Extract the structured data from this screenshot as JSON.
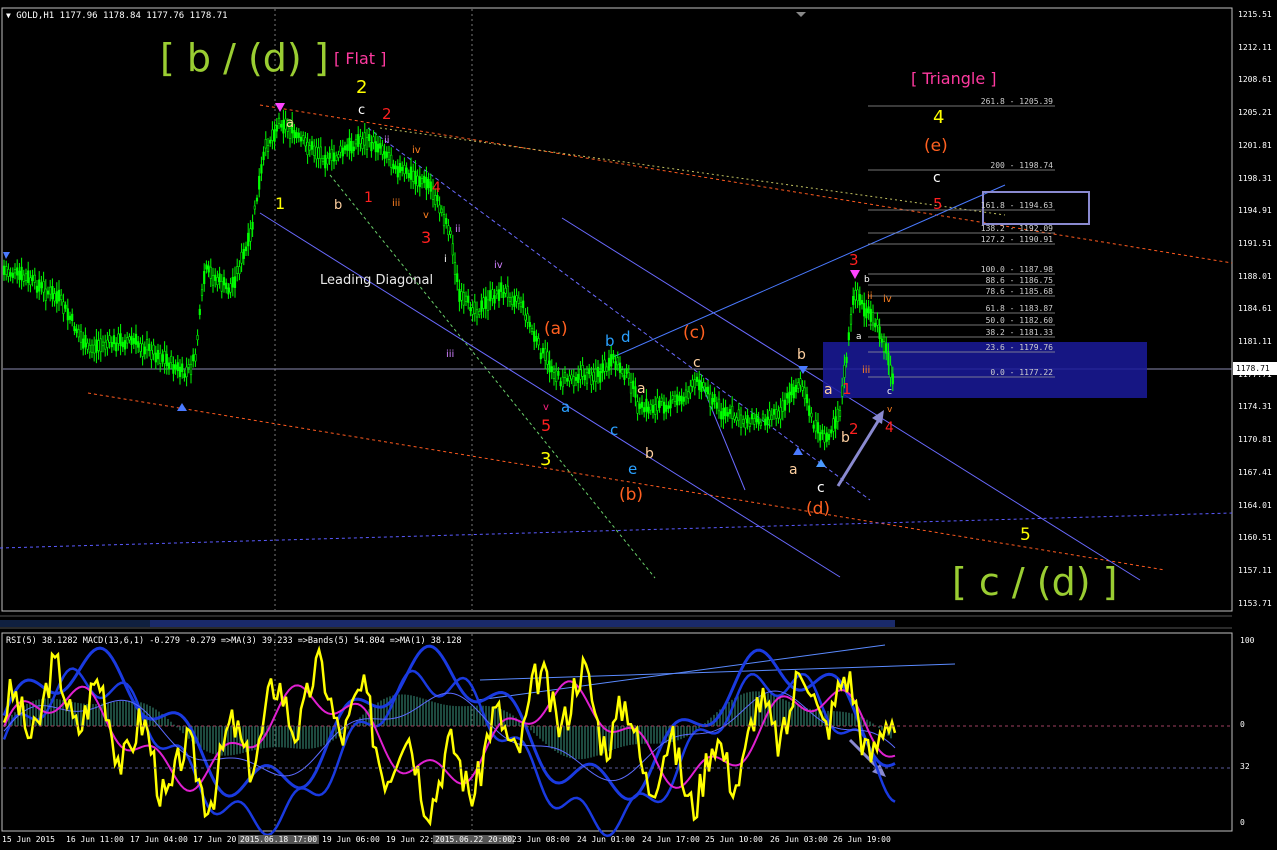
{
  "header": {
    "symbol_line": "GOLD,H1  1177.96 1178.84 1177.76 1178.71",
    "dropdown_icon": "triangle-down-icon"
  },
  "price_axis": {
    "ticks": [
      "1215.51",
      "1212.11",
      "1208.61",
      "1205.21",
      "1201.81",
      "1198.31",
      "1194.91",
      "1191.51",
      "1188.01",
      "1184.61",
      "1181.11",
      "1177.71",
      "1174.31",
      "1170.81",
      "1167.41",
      "1164.01",
      "1160.51",
      "1157.11",
      "1153.71"
    ],
    "current_price": "1178.71"
  },
  "time_axis": {
    "labels": [
      "15 Jun 2015",
      "16 Jun 11:00",
      "17 Jun 04:00",
      "17 Jun 20:00",
      "2015.06.18 17:00",
      "19 Jun 06:00",
      "19 Jun 22:00",
      "2015.06.22 20:00",
      "23 Jun 08:00",
      "24 Jun 01:00",
      "24 Jun 17:00",
      "25 Jun 10:00",
      "26 Jun 03:00",
      "26 Jun 19:00"
    ]
  },
  "annotations": {
    "big_b_d": "[ b / (d) ]",
    "big_c_d": "[ c / (d) ]",
    "flat": "[ Flat ]",
    "triangle": "[ Triangle ]",
    "leading_diagonal": "Leading Diagonal",
    "wave_labels": [
      {
        "t": "2"
      },
      {
        "t": "c"
      },
      {
        "t": "a"
      },
      {
        "t": "2"
      },
      {
        "t": "1"
      },
      {
        "t": "b"
      },
      {
        "t": "1"
      },
      {
        "t": "ii"
      },
      {
        "t": "iv"
      },
      {
        "t": "iii"
      },
      {
        "t": "4"
      },
      {
        "t": "v"
      },
      {
        "t": "3"
      },
      {
        "t": "ii"
      },
      {
        "t": "i"
      },
      {
        "t": "iv"
      },
      {
        "t": "iii"
      },
      {
        "t": "(a)"
      },
      {
        "t": "b"
      },
      {
        "t": "d"
      },
      {
        "t": "v"
      },
      {
        "t": "a"
      },
      {
        "t": "5"
      },
      {
        "t": "3"
      },
      {
        "t": "c"
      },
      {
        "t": "a"
      },
      {
        "t": "e"
      },
      {
        "t": "b"
      },
      {
        "t": "(b)"
      },
      {
        "t": "(c)"
      },
      {
        "t": "c"
      },
      {
        "t": "b"
      },
      {
        "t": "a"
      },
      {
        "t": "a"
      },
      {
        "t": "1"
      },
      {
        "t": "2"
      },
      {
        "t": "b"
      },
      {
        "t": "c"
      },
      {
        "t": "(d)"
      },
      {
        "t": "3"
      },
      {
        "t": "b"
      },
      {
        "t": "ii"
      },
      {
        "t": "iv"
      },
      {
        "t": "a"
      },
      {
        "t": "iii"
      },
      {
        "t": "c"
      },
      {
        "t": "v"
      },
      {
        "t": "4"
      },
      {
        "t": "4"
      },
      {
        "t": "(e)"
      },
      {
        "t": "c"
      },
      {
        "t": "5"
      },
      {
        "t": "5"
      }
    ],
    "fib_levels": [
      {
        "label": "261.8 - 1205.39"
      },
      {
        "label": "200 - 1198.74"
      },
      {
        "label": "161.8 - 1194.63"
      },
      {
        "label": "138.2 - 1192.09"
      },
      {
        "label": "127.2 - 1190.91"
      },
      {
        "label": "100.0 - 1187.98"
      },
      {
        "label": "88.6 - 1186.75"
      },
      {
        "label": "78.6 - 1185.68"
      },
      {
        "label": "61.8 - 1183.87"
      },
      {
        "label": "50.0 - 1182.60"
      },
      {
        "label": "38.2 - 1181.33"
      },
      {
        "label": "23.6 - 1179.76"
      },
      {
        "label": "0.0 - 1177.22"
      }
    ]
  },
  "indicator": {
    "header_line": "RSI(5) 38.1282  MACD(13,6,1) -0.279 -0.279  =>MA(3) 39.233  =>Bands(5) 54.804  =>MA(1) 38.128",
    "axis_ticks": [
      "100",
      "0",
      "32",
      "0"
    ]
  },
  "colors": {
    "candle": "#00ff00",
    "bg": "#000000",
    "yellow": "#ffff00",
    "magenta": "#ff00ff",
    "lime_text": "#9acd32"
  }
}
